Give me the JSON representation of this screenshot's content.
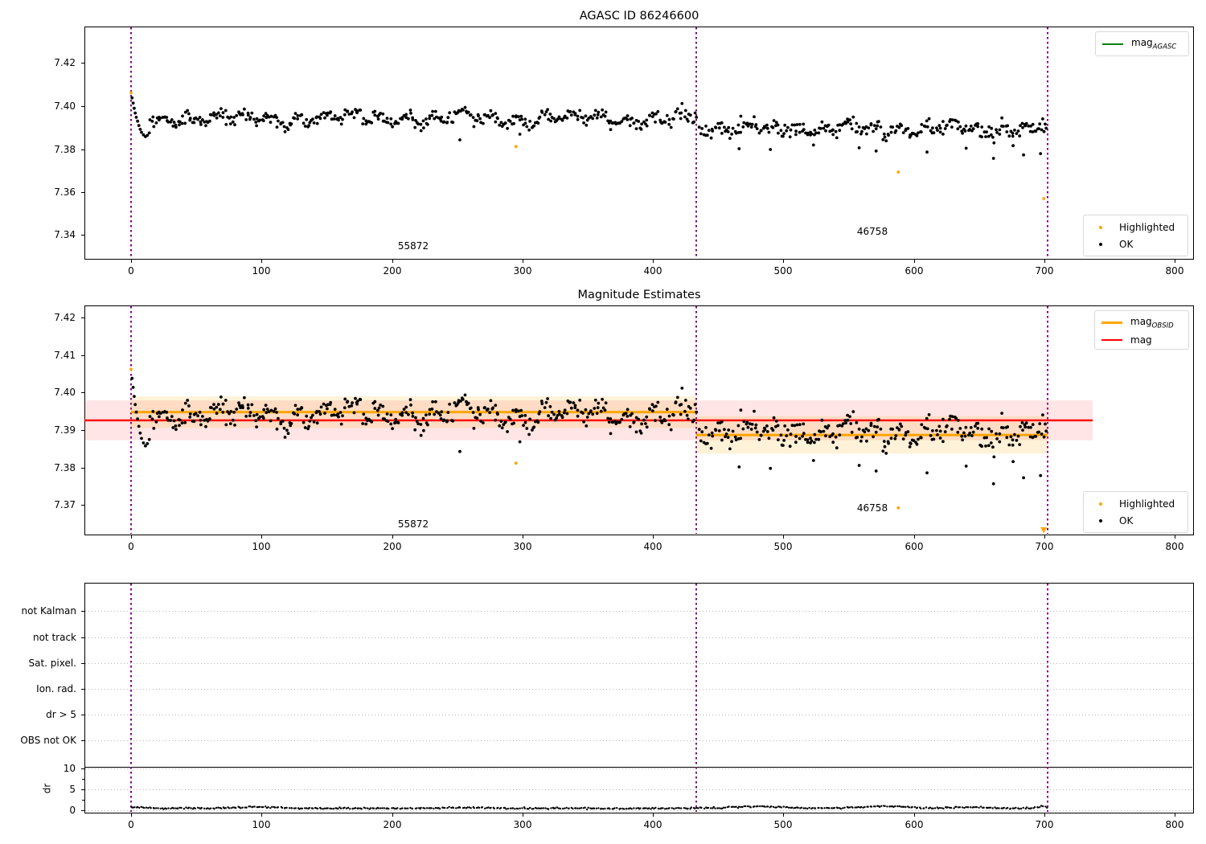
{
  "ui": {
    "xticks": [
      "0",
      "100",
      "200",
      "300",
      "400",
      "500",
      "600",
      "700",
      "800"
    ],
    "p1": {
      "title": "AGASC ID 86246600",
      "yticks": [
        "7.42",
        "7.40",
        "7.38",
        "7.36",
        "7.34"
      ],
      "legend_mag_main": "mag",
      "legend_mag_sub": "AGASC",
      "legend_highlighted": "Highlighted",
      "legend_ok": "OK",
      "obsid_label_1": "55872",
      "obsid_label_2": "46758"
    },
    "p2": {
      "title": "Magnitude Estimates",
      "yticks": [
        "7.42",
        "7.41",
        "7.40",
        "7.39",
        "7.38",
        "7.37"
      ],
      "legend_obsid_main": "mag",
      "legend_obsid_sub": "OBSID",
      "legend_mag": "mag",
      "legend_highlighted": "Highlighted",
      "legend_ok": "OK",
      "obsid_label_1": "55872",
      "obsid_label_2": "46758"
    },
    "p3": {
      "flags": [
        "not Kalman",
        "not track",
        "Sat. pixel.",
        "Ion. rad.",
        "dr > 5",
        "OBS not OK"
      ],
      "dr_ticks": [
        "10",
        "5",
        "0"
      ],
      "dr_axis_label": "dr"
    }
  },
  "colors": {
    "ok": "#000000",
    "highlighted": "#ffa500",
    "mag_agasc_line": "#008000",
    "mag_line": "#ff0000",
    "mag_band": "rgba(255,0,0,0.10)",
    "obsid_line": "#ffa500",
    "obsid_band": "rgba(255,165,0,0.15)",
    "vline": "#800080",
    "grid": "#b5b5b5"
  },
  "chart_data": [
    {
      "type": "scatter",
      "panel": "top",
      "title": "AGASC ID 86246600",
      "xlim": [
        -36,
        814
      ],
      "ylim": [
        7.329,
        7.437
      ],
      "xticks": [
        0,
        100,
        200,
        300,
        400,
        500,
        600,
        700,
        800
      ],
      "yticks": [
        7.34,
        7.36,
        7.38,
        7.4,
        7.42
      ],
      "vlines": {
        "x": [
          0,
          433,
          702.5
        ],
        "color": "#800080",
        "style": "dotted"
      },
      "legend_top": [
        {
          "label": "mag_AGASC",
          "color": "#008000",
          "kind": "line"
        }
      ],
      "legend_bottom": [
        {
          "label": "Highlighted",
          "color": "#ffa500",
          "kind": "point"
        },
        {
          "label": "OK",
          "color": "#000000",
          "kind": "point"
        }
      ],
      "annotations": [
        {
          "text": "55872",
          "x": 216
        },
        {
          "text": "46758",
          "x": 568
        }
      ],
      "ok_summary": [
        {
          "x_range": [
            0,
            433
          ],
          "mean_mag": 7.3943,
          "scatter": 0.004
        },
        {
          "x_range": [
            433,
            703
          ],
          "mean_mag": 7.3893,
          "scatter": 0.004
        }
      ],
      "highlighted_points": [
        [
          0,
          7.4062
        ],
        [
          295,
          7.3812
        ],
        [
          588,
          7.3693
        ],
        [
          699.5,
          7.357
        ]
      ]
    },
    {
      "type": "scatter",
      "panel": "middle",
      "title": "Magnitude Estimates",
      "xlim": [
        -36,
        814
      ],
      "ylim": [
        7.3622,
        7.4232
      ],
      "xticks": [
        0,
        100,
        200,
        300,
        400,
        500,
        600,
        700,
        800
      ],
      "yticks": [
        7.37,
        7.38,
        7.39,
        7.4,
        7.41,
        7.42
      ],
      "vlines": {
        "x": [
          0,
          433,
          702.5
        ],
        "color": "#800080",
        "style": "dotted"
      },
      "mag_line": {
        "y": 7.3926,
        "x": [
          -36,
          737
        ],
        "band": [
          7.3873,
          7.3979
        ]
      },
      "obsid_segments": [
        {
          "x_range": [
            0,
            433
          ],
          "y": 7.3948,
          "band": [
            7.3906,
            7.399
          ]
        },
        {
          "x_range": [
            433,
            702.5
          ],
          "y": 7.3887,
          "band": [
            7.3837,
            7.3937
          ]
        }
      ],
      "legend_top": [
        {
          "label": "mag_OBSID",
          "color": "#ffa500",
          "kind": "line"
        },
        {
          "label": "mag",
          "color": "#ff0000",
          "kind": "line"
        }
      ],
      "legend_bottom": [
        {
          "label": "Highlighted",
          "color": "#ffa500",
          "kind": "point"
        },
        {
          "label": "OK",
          "color": "#000000",
          "kind": "point"
        }
      ],
      "annotations": [
        {
          "text": "55872",
          "x": 216
        },
        {
          "text": "46758",
          "x": 568
        }
      ],
      "highlighted_points": [
        [
          0,
          7.4062
        ],
        [
          295,
          7.3812
        ],
        [
          588,
          7.3693
        ],
        [
          699.5,
          7.357
        ]
      ],
      "clipped_highlighted_points": [
        [
          699.5,
          7.357
        ]
      ]
    },
    {
      "type": "scatter",
      "panel": "bottom",
      "flag_rows": [
        "not Kalman",
        "not track",
        "Sat. pixel.",
        "Ion. rad.",
        "dr > 5",
        "OBS not OK"
      ],
      "flag_points": "none",
      "dr_axis": {
        "label": "dr",
        "ticks": [
          0,
          5,
          10
        ],
        "ylim": [
          0,
          11
        ],
        "top_hline": true
      },
      "dr_summary": {
        "x_range": [
          0,
          702
        ],
        "typical_value": 0.4,
        "max_bump": 0.9
      },
      "vlines": {
        "x": [
          0,
          433,
          702.5
        ],
        "color": "#800080",
        "style": "dotted"
      },
      "xticks": [
        0,
        100,
        200,
        300,
        400,
        500,
        600,
        700,
        800
      ]
    }
  ],
  "synth": {
    "transient": [
      [
        0.8,
        7.4038
      ],
      [
        1.6,
        7.4014
      ],
      [
        2.4,
        7.399
      ],
      [
        3.2,
        7.3968
      ],
      [
        4.0,
        7.3948
      ],
      [
        5.0,
        7.393
      ],
      [
        6.0,
        7.391
      ],
      [
        7.0,
        7.3892
      ],
      [
        8.0,
        7.3878
      ],
      [
        9.5,
        7.3866
      ],
      [
        11.0,
        7.3858
      ],
      [
        12.5,
        7.3864
      ],
      [
        14.0,
        7.3875
      ]
    ],
    "segA": {
      "x0": 15,
      "x1": 433,
      "n": 418,
      "base": 7.3943,
      "noise": 0.0015,
      "s1": 0.0019,
      "p1": 21,
      "f1": 0.9,
      "s2": 0.0013,
      "p2": 87,
      "f2": 2.0,
      "seed": 101
    },
    "segB": {
      "x0": 436,
      "x1": 702,
      "n": 260,
      "base": 7.3895,
      "noise": 0.0017,
      "s1": 0.0018,
      "p1": 19.5,
      "f1": 0.2,
      "s2": 0.0013,
      "p2": 73,
      "f2": 4.0,
      "seed": 202
    },
    "outliers": [
      [
        252,
        7.3843
      ],
      [
        298,
        7.3869
      ],
      [
        466,
        7.3802
      ],
      [
        490,
        7.3798
      ],
      [
        523,
        7.3819
      ],
      [
        558,
        7.3806
      ],
      [
        571,
        7.3791
      ],
      [
        610,
        7.3786
      ],
      [
        640,
        7.3804
      ],
      [
        661,
        7.3757
      ],
      [
        676,
        7.3816
      ],
      [
        684,
        7.3773
      ],
      [
        697,
        7.3779
      ]
    ],
    "highlighted": [
      [
        0,
        7.4062
      ],
      [
        295,
        7.3812
      ],
      [
        588,
        7.3693
      ],
      [
        699.5,
        7.357
      ]
    ],
    "dr": {
      "x0": 0,
      "x1": 702,
      "n": 540,
      "base": 0.36,
      "noise": 0.09,
      "seed": 303,
      "bumps": [
        [
          3,
          0.3,
          5
        ],
        [
          92,
          0.3,
          16
        ],
        [
          258,
          0.22,
          13
        ],
        [
          480,
          0.45,
          20
        ],
        [
          578,
          0.5,
          18
        ],
        [
          642,
          0.28,
          13
        ],
        [
          699,
          0.4,
          5
        ]
      ]
    }
  }
}
